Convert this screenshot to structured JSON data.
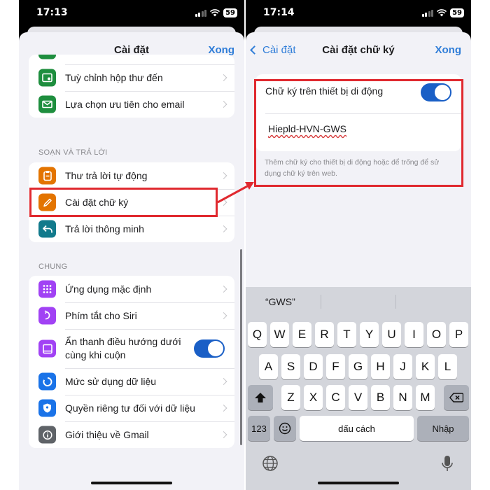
{
  "left_screen": {
    "status": {
      "time": "17:13",
      "battery": "59"
    },
    "nav": {
      "title": "Cài đặt",
      "done": "Xong"
    },
    "top_group": [
      {
        "label": "Tuỳ chỉnh hộp thư đến",
        "icon": "inbox-settings-icon",
        "color": "#1e8e3e"
      },
      {
        "label": "Lựa chọn ưu tiên cho email",
        "icon": "mail-icon",
        "color": "#1e8e3e"
      }
    ],
    "compose_header": "SOẠN VÀ TRẢ LỜI",
    "compose_group": [
      {
        "label": "Thư trả lời tự động",
        "icon": "auto-reply-icon",
        "color": "#e37400"
      },
      {
        "label": "Cài đặt chữ ký",
        "icon": "pen-icon",
        "color": "#e37400"
      },
      {
        "label": "Trả lời thông minh",
        "icon": "reply-icon",
        "color": "#127a8c"
      }
    ],
    "general_header": "CHUNG",
    "general_group": [
      {
        "label": "Ứng dụng mặc định",
        "icon": "apps-grid-icon",
        "color": "#a142f4"
      },
      {
        "label": "Phím tắt cho Siri",
        "icon": "siri-shortcut-icon",
        "color": "#a142f4"
      },
      {
        "label_line1": "Ẩn thanh điều hướng dưới",
        "label_line2": "cùng khi cuộn",
        "icon": "bottom-bar-icon",
        "color": "#a142f4",
        "toggle": true
      },
      {
        "label": "Mức sử dụng dữ liệu",
        "icon": "data-usage-icon",
        "color": "#1a73e8"
      },
      {
        "label": "Quyền riêng tư đối với dữ liệu",
        "icon": "shield-icon",
        "color": "#1a73e8"
      },
      {
        "label": "Giới thiệu về Gmail",
        "icon": "info-icon",
        "color": "#5f6368"
      }
    ]
  },
  "right_screen": {
    "status": {
      "time": "17:14",
      "battery": "59"
    },
    "nav": {
      "back": "Cài đặt",
      "title": "Cài đặt chữ ký",
      "done": "Xong"
    },
    "signature_toggle_label": "Chữ ký trên thiết bị di động",
    "signature_toggle_on": true,
    "signature_value": "Hiepld-HVN-GWS",
    "footer_note": "Thêm chữ ký cho thiết bị di động hoặc để trống để sử dụng chữ ký trên web.",
    "keyboard": {
      "suggestion": "“GWS”",
      "row1": [
        "Q",
        "W",
        "E",
        "R",
        "T",
        "Y",
        "U",
        "I",
        "O",
        "P"
      ],
      "row2": [
        "A",
        "S",
        "D",
        "F",
        "G",
        "H",
        "J",
        "K",
        "L"
      ],
      "row3": [
        "Z",
        "X",
        "C",
        "V",
        "B",
        "N",
        "M"
      ],
      "key_123": "123",
      "space": "dấu cách",
      "return": "Nhập"
    }
  },
  "colors": {
    "accent": "#2f7dd8",
    "highlight": "#e0292f",
    "toggle": "#1a5fc6"
  }
}
